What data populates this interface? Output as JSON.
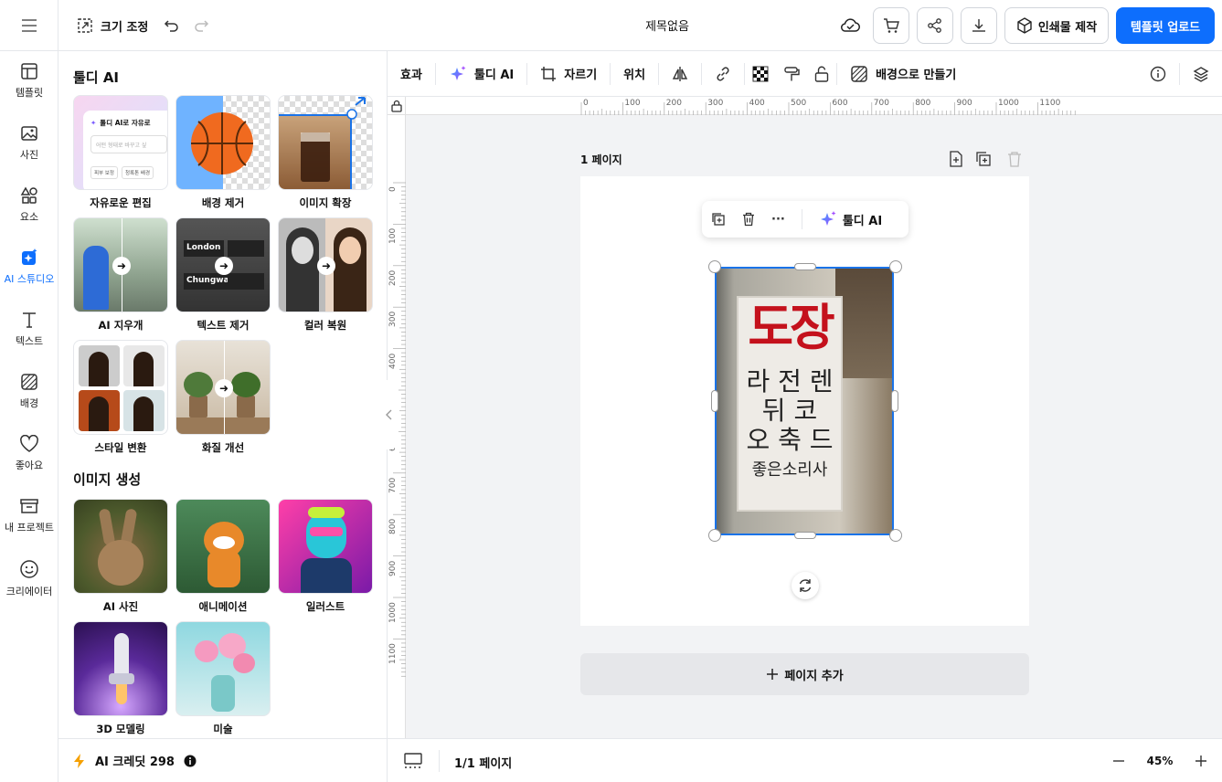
{
  "topbar": {
    "resize_label": "크기 조정",
    "doc_title": "제목없음",
    "print_label": "인쇄물 제작",
    "upload_label": "템플릿 업로드"
  },
  "rail": {
    "items": [
      {
        "label": "템플릿",
        "icon": "template-icon"
      },
      {
        "label": "사진",
        "icon": "photo-icon"
      },
      {
        "label": "요소",
        "icon": "shapes-icon"
      },
      {
        "label": "AI 스튜디오",
        "icon": "ai-sparkle-icon"
      },
      {
        "label": "텍스트",
        "icon": "text-icon"
      },
      {
        "label": "배경",
        "icon": "background-icon"
      },
      {
        "label": "좋아요",
        "icon": "heart-icon"
      },
      {
        "label": "내 프로젝트",
        "icon": "folder-icon"
      },
      {
        "label": "크리에이터",
        "icon": "smile-icon"
      }
    ]
  },
  "panel": {
    "section1_title": "툴디 AI",
    "tools": [
      {
        "label": "자유로운 편집"
      },
      {
        "label": "배경 제거"
      },
      {
        "label": "이미지 확장"
      },
      {
        "label": "AI 지우개"
      },
      {
        "label": "텍스트 제거"
      },
      {
        "label": "컬러 복원"
      },
      {
        "label": "스타일 변환"
      },
      {
        "label": "화질 개선"
      }
    ],
    "free_edit_thumb": {
      "title": "툴디 AI로 자유로",
      "placeholder": "어떤 형태로 바꾸고 싶",
      "chip1": "피부 보정",
      "chip2": "청록톤 배경"
    },
    "text_remove_thumb": {
      "sign1": "London",
      "sign2": "Chungwa"
    },
    "section2_title": "이미지 생성",
    "gens": [
      {
        "label": "AI 사진"
      },
      {
        "label": "애니메이션"
      },
      {
        "label": "일러스트"
      },
      {
        "label": "3D 모델링"
      },
      {
        "label": "미술"
      }
    ],
    "credit_label": "AI 크레딧 298"
  },
  "toolbar": {
    "effects": "효과",
    "toolidi_ai": "툴디 AI",
    "crop": "자르기",
    "position": "위치",
    "make_background": "배경으로 만들기"
  },
  "canvas": {
    "ruler_x": [
      "0",
      "100",
      "200",
      "300",
      "400",
      "500",
      "600",
      "700",
      "800",
      "900",
      "1000",
      "1100"
    ],
    "ruler_y": [
      "0",
      "100",
      "200",
      "300",
      "400",
      "500",
      "600",
      "700",
      "800",
      "900",
      "1000",
      "1100"
    ],
    "page_label": "1 페이지",
    "float_ai_label": "툴디 AI",
    "float_more": "···",
    "sign_title": "도장",
    "sign_line1": "라 전 렌",
    "sign_line2": "뒤 코",
    "sign_line3": "오 축 드",
    "sign_line4": "좋은소리사",
    "add_page_label": "페이지 추가"
  },
  "bottombar": {
    "page_count": "1/1 페이지",
    "zoom": "45%"
  }
}
